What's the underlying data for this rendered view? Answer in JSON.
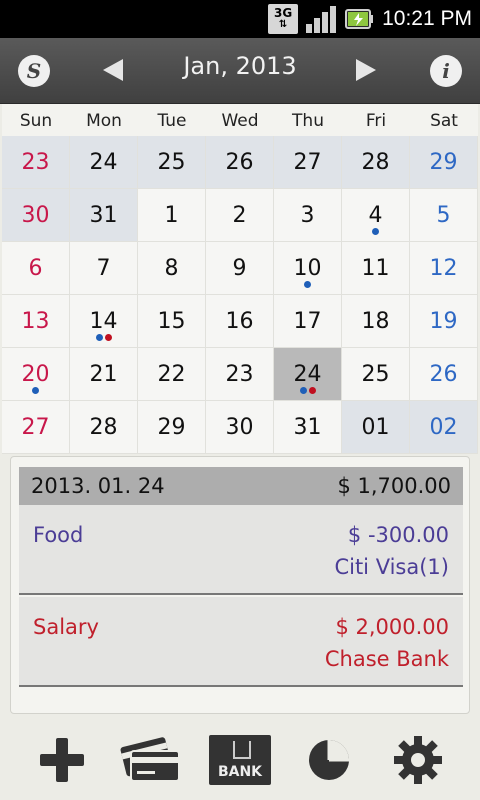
{
  "status_bar": {
    "network": "3G",
    "time": "10:21 PM"
  },
  "header": {
    "title": "Jan, 2013",
    "left_icon": "s-logo-icon",
    "right_icon": "info-icon"
  },
  "weekdays": [
    "Sun",
    "Mon",
    "Tue",
    "Wed",
    "Thu",
    "Fri",
    "Sat"
  ],
  "calendar": {
    "weeks": [
      [
        {
          "d": "23",
          "other": true
        },
        {
          "d": "24",
          "other": true
        },
        {
          "d": "25",
          "other": true
        },
        {
          "d": "26",
          "other": true
        },
        {
          "d": "27",
          "other": true
        },
        {
          "d": "28",
          "other": true
        },
        {
          "d": "29",
          "other": true
        }
      ],
      [
        {
          "d": "30",
          "other": true
        },
        {
          "d": "31",
          "other": true
        },
        {
          "d": "1"
        },
        {
          "d": "2"
        },
        {
          "d": "3"
        },
        {
          "d": "4",
          "dots": [
            "blue"
          ]
        },
        {
          "d": "5"
        }
      ],
      [
        {
          "d": "6"
        },
        {
          "d": "7"
        },
        {
          "d": "8"
        },
        {
          "d": "9"
        },
        {
          "d": "10",
          "dots": [
            "blue"
          ]
        },
        {
          "d": "11"
        },
        {
          "d": "12"
        }
      ],
      [
        {
          "d": "13"
        },
        {
          "d": "14",
          "dots": [
            "blue",
            "red"
          ]
        },
        {
          "d": "15"
        },
        {
          "d": "16"
        },
        {
          "d": "17"
        },
        {
          "d": "18"
        },
        {
          "d": "19"
        }
      ],
      [
        {
          "d": "20",
          "dots": [
            "blue"
          ]
        },
        {
          "d": "21"
        },
        {
          "d": "22"
        },
        {
          "d": "23"
        },
        {
          "d": "24",
          "selected": true,
          "dots": [
            "blue",
            "red"
          ]
        },
        {
          "d": "25"
        },
        {
          "d": "26"
        }
      ],
      [
        {
          "d": "27"
        },
        {
          "d": "28"
        },
        {
          "d": "29"
        },
        {
          "d": "30"
        },
        {
          "d": "31"
        },
        {
          "d": "01",
          "other": true
        },
        {
          "d": "02",
          "other": true
        }
      ]
    ]
  },
  "detail": {
    "date": "2013. 01. 24",
    "total": "$ 1,700.00",
    "entries": [
      {
        "category": "Food",
        "amount": "$ -300.00",
        "account": "Citi Visa(1)"
      },
      {
        "category": "Salary",
        "amount": "$ 2,000.00",
        "account": "Chase Bank"
      }
    ]
  },
  "toolbar": {
    "bank_label": "BANK",
    "items": [
      "add-icon",
      "cards-icon",
      "bank-icon",
      "pie-chart-icon",
      "gear-icon"
    ]
  },
  "colors": {
    "sunday": "#c8174a",
    "saturday": "#2e68c4",
    "expense": "#4b3d96",
    "income": "#c0202c",
    "dot_blue": "#1f5fb8",
    "dot_red": "#c01020"
  }
}
